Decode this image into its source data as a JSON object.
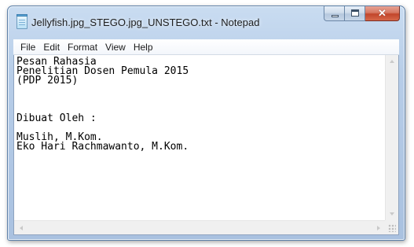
{
  "window": {
    "title": "Jellyfish.jpg_STEGO.jpg_UNSTEGO.txt - Notepad",
    "icon": "notepad-icon",
    "caption_buttons": {
      "minimize": "minimize-icon",
      "maximize": "maximize-icon",
      "close": "close-icon",
      "close_glyph": "✕"
    }
  },
  "menu": {
    "file": "File",
    "edit": "Edit",
    "format": "Format",
    "view": "View",
    "help": "Help"
  },
  "editor": {
    "lines": [
      "Pesan Rahasia",
      "Penelitian Dosen Pemula 2015",
      "(PDP 2015)",
      "",
      "",
      "",
      "Dibuat Oleh :",
      "",
      "Muslih, M.Kom.",
      "Eko Hari Rachmawanto, M.Kom."
    ]
  },
  "colors": {
    "titlebar": "#b7cde8",
    "close_button": "#c2462b"
  }
}
